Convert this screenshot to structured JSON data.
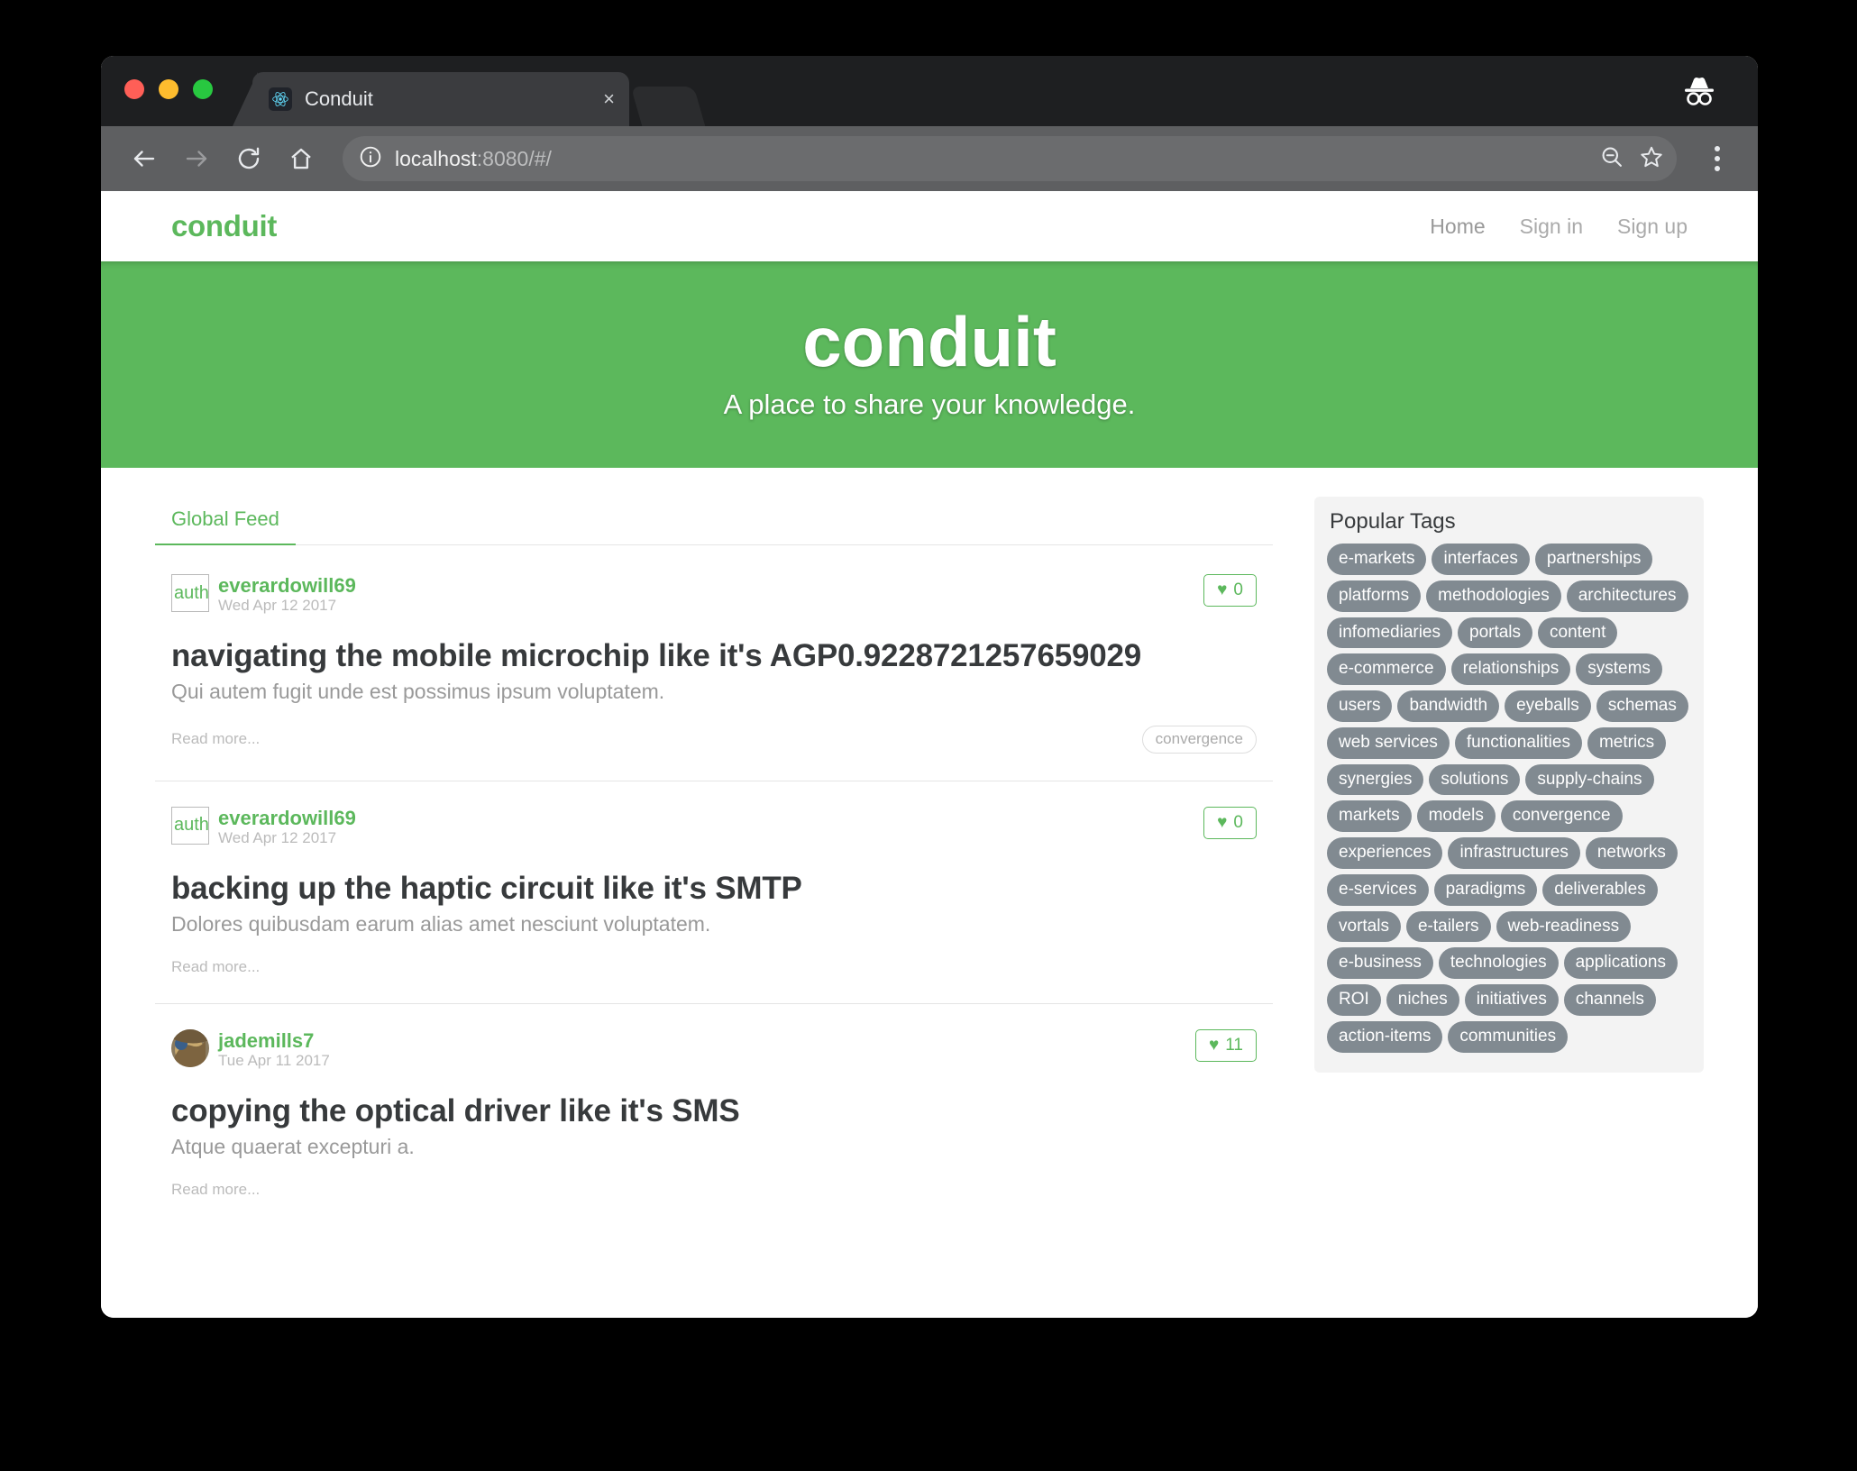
{
  "browser": {
    "tab_title": "Conduit",
    "tab_close_label": "×",
    "url_host": "localhost",
    "url_rest": ":8080/#/",
    "icons": {
      "favicon": "react-logo-icon",
      "back": "back-arrow-icon",
      "forward": "forward-arrow-icon",
      "reload": "reload-icon",
      "home": "home-icon",
      "info": "info-circle-icon",
      "zoom_out": "zoom-out-icon",
      "bookmark": "star-icon",
      "menu": "kebab-menu-icon",
      "incognito": "incognito-icon"
    }
  },
  "navbar": {
    "brand": "conduit",
    "links": [
      {
        "label": "Home",
        "active": true
      },
      {
        "label": "Sign in",
        "active": false
      },
      {
        "label": "Sign up",
        "active": false
      }
    ]
  },
  "banner": {
    "title": "conduit",
    "subtitle": "A place to share your knowledge."
  },
  "feed": {
    "tabs": [
      {
        "label": "Global Feed",
        "active": true
      }
    ],
    "articles": [
      {
        "author": "everardowill69",
        "avatar_type": "broken",
        "avatar_alt": "auth",
        "date": "Wed Apr 12 2017",
        "favorites_count": "0",
        "title": "navigating the mobile microchip like it's AGP0.9228721257659029",
        "description": "Qui autem fugit unde est possimus ipsum voluptatem.",
        "read_more": "Read more...",
        "tags": [
          "convergence"
        ]
      },
      {
        "author": "everardowill69",
        "avatar_type": "broken",
        "avatar_alt": "auth",
        "date": "Wed Apr 12 2017",
        "favorites_count": "0",
        "title": "backing up the haptic circuit like it's SMTP",
        "description": "Dolores quibusdam earum alias amet nesciunt voluptatem.",
        "read_more": "Read more...",
        "tags": []
      },
      {
        "author": "jademills7",
        "avatar_type": "photo",
        "avatar_alt": "",
        "date": "Tue Apr 11 2017",
        "favorites_count": "11",
        "title": "copying the optical driver like it's SMS",
        "description": "Atque quaerat excepturi a.",
        "read_more": "Read more...",
        "tags": []
      }
    ]
  },
  "sidebar": {
    "title": "Popular Tags",
    "tags": [
      "e-markets",
      "interfaces",
      "partnerships",
      "platforms",
      "methodologies",
      "architectures",
      "infomediaries",
      "portals",
      "content",
      "e-commerce",
      "relationships",
      "systems",
      "users",
      "bandwidth",
      "eyeballs",
      "schemas",
      "web services",
      "functionalities",
      "metrics",
      "synergies",
      "solutions",
      "supply-chains",
      "markets",
      "models",
      "convergence",
      "experiences",
      "infrastructures",
      "networks",
      "e-services",
      "paradigms",
      "deliverables",
      "vortals",
      "e-tailers",
      "web-readiness",
      "e-business",
      "technologies",
      "applications",
      "ROI",
      "niches",
      "initiatives",
      "channels",
      "action-items",
      "communities"
    ]
  },
  "colors": {
    "brand_green": "#5CB85C",
    "tag_gray": "#818a91",
    "muted": "#bbbbbb"
  }
}
